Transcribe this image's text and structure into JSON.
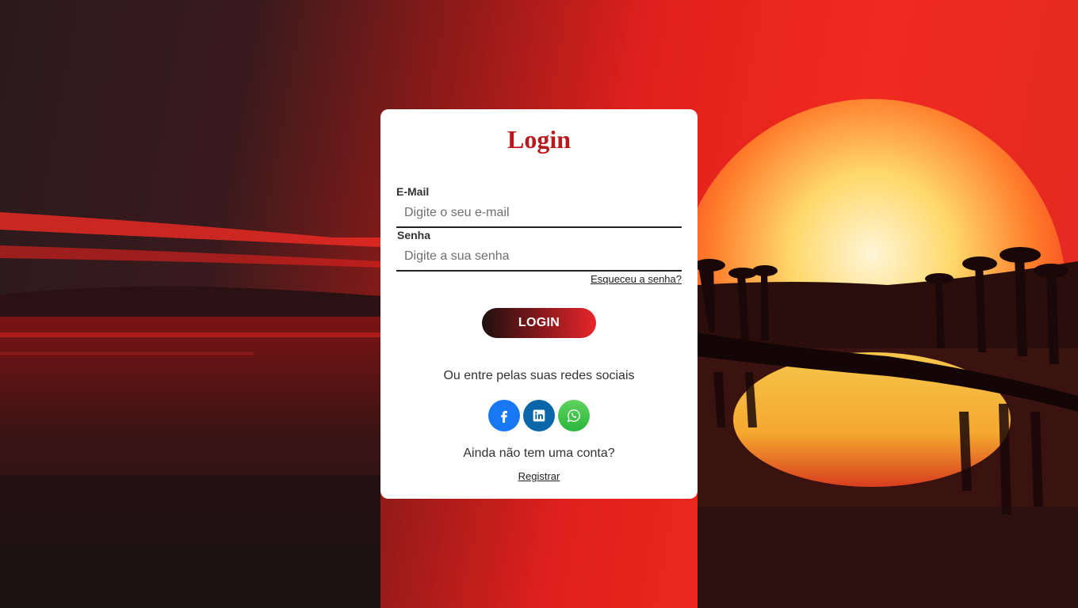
{
  "login_card": {
    "title": "Login",
    "email": {
      "label": "E-Mail",
      "placeholder": "Digite o seu e-mail",
      "value": ""
    },
    "password": {
      "label": "Senha",
      "placeholder": "Digite a sua senha",
      "value": ""
    },
    "forgot_link": "Esqueceu a senha?",
    "login_button": "LOGIN",
    "social_prompt": "Ou entre pelas suas redes sociais",
    "social_buttons": [
      {
        "icon": "facebook-icon",
        "color": "#1877f2"
      },
      {
        "icon": "linkedin-icon",
        "color": "#0a66a8"
      },
      {
        "icon": "whatsapp-icon",
        "color": "#3cc24a"
      }
    ],
    "no_account_text": "Ainda não tem uma conta?",
    "register_link": "Registrar"
  },
  "colors": {
    "title": "#b8191c",
    "button_gradient_start": "#1e1011",
    "button_gradient_end": "#e8252a"
  }
}
